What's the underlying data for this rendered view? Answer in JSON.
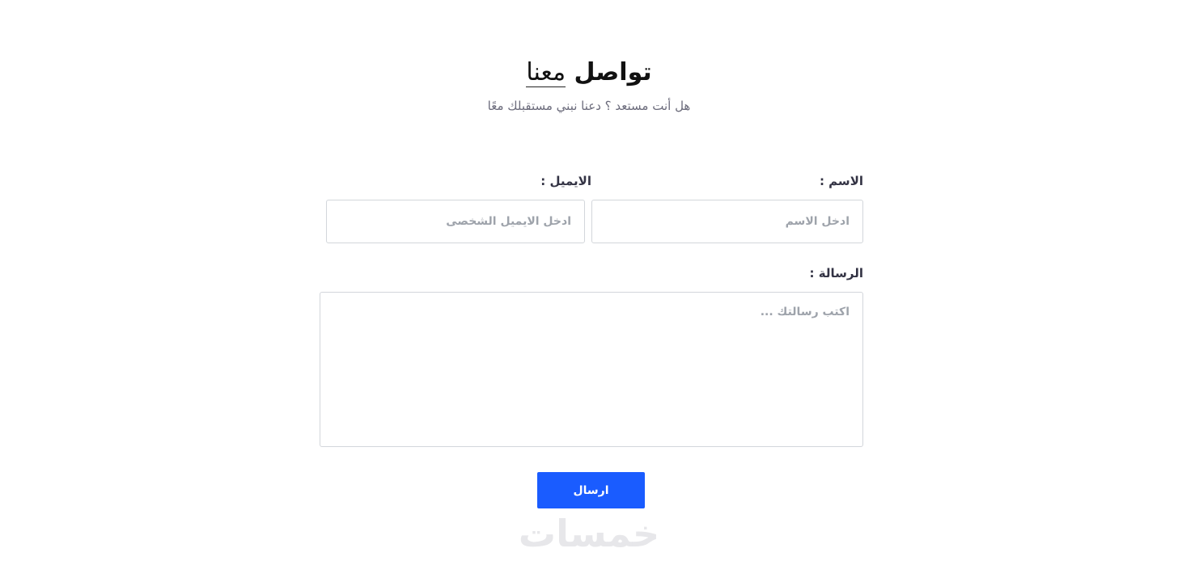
{
  "header": {
    "title_main": "تواصل",
    "title_underlined": "معنا",
    "subtitle": "هل أنت مستعد ؟ دعنا نبني مستقبلك معًا"
  },
  "form": {
    "name": {
      "label": "الاسم :",
      "placeholder": "ادخل الاسم",
      "value": ""
    },
    "email": {
      "label": "الايميل :",
      "placeholder": "ادخل الايميل الشخصى",
      "value": ""
    },
    "message": {
      "label": "الرسالة :",
      "placeholder": "اكتب رسالتك ...",
      "value": ""
    },
    "submit_label": "ارسال"
  },
  "watermark": {
    "text": "خمسات"
  },
  "colors": {
    "accent": "#1a5cff",
    "border": "#d3d6db",
    "placeholder": "#9ea3ab",
    "subtitle": "#6b6b7b",
    "watermark": "#e7e7ea"
  }
}
